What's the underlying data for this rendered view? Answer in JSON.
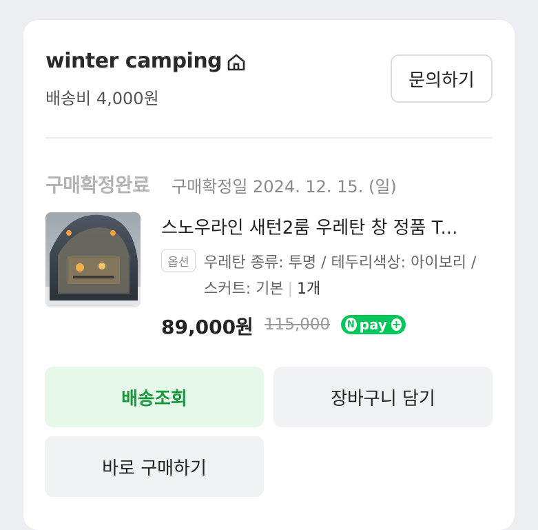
{
  "seller": {
    "name": "winter camping",
    "shipping": "배송비 4,000원",
    "inquiry_label": "문의하기"
  },
  "order": {
    "status": "구매확정완료",
    "confirm_date": "구매확정일 2024. 12. 15. (일)"
  },
  "product": {
    "title": "스노우라인 새턴2룸 우레탄 창 정품 T...",
    "option_badge": "옵션",
    "option_text": "우레탄 종류: 투명 / 테두리색상: 아이보리 / 스커트: 기본",
    "quantity": "1개",
    "price": "89,000원",
    "original_price": "115,000",
    "npay_letter": "N",
    "npay_label": "pay",
    "npay_plus": "+"
  },
  "actions": {
    "track": "배송조회",
    "cart": "장바구니 담기",
    "buy_again": "바로 구매하기"
  },
  "colors": {
    "npay_green": "#03c75a",
    "track_text": "#16973b",
    "track_bg": "#e5f8ea"
  }
}
